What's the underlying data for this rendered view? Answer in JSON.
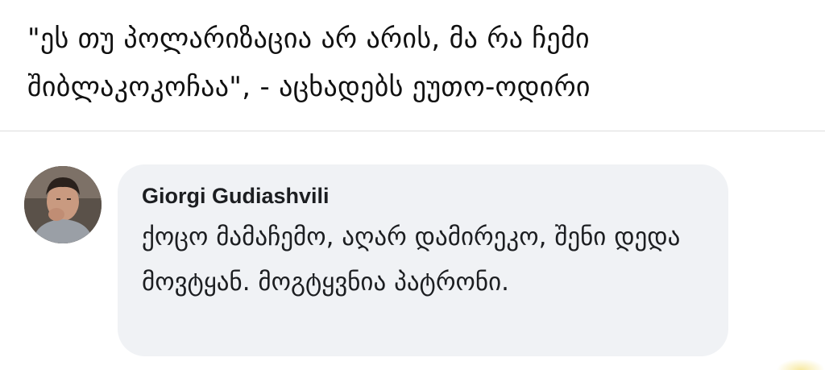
{
  "headline": {
    "text": "\"ეს თუ პოლარიზაცია არ არის, მა რა ჩემი შიბლაკოკოჩაა\", - აცხადებს ეუთო-ოდირი"
  },
  "comment": {
    "author": "Giorgi Gudiashvili",
    "text": "ქოცო მამაჩემო, აღარ დამირეკო, შენი დედა მოვტყან. მოგტყვნია პატრონი."
  },
  "colors": {
    "bubble_background": "#f0f2f5",
    "text": "#1c1e21"
  }
}
